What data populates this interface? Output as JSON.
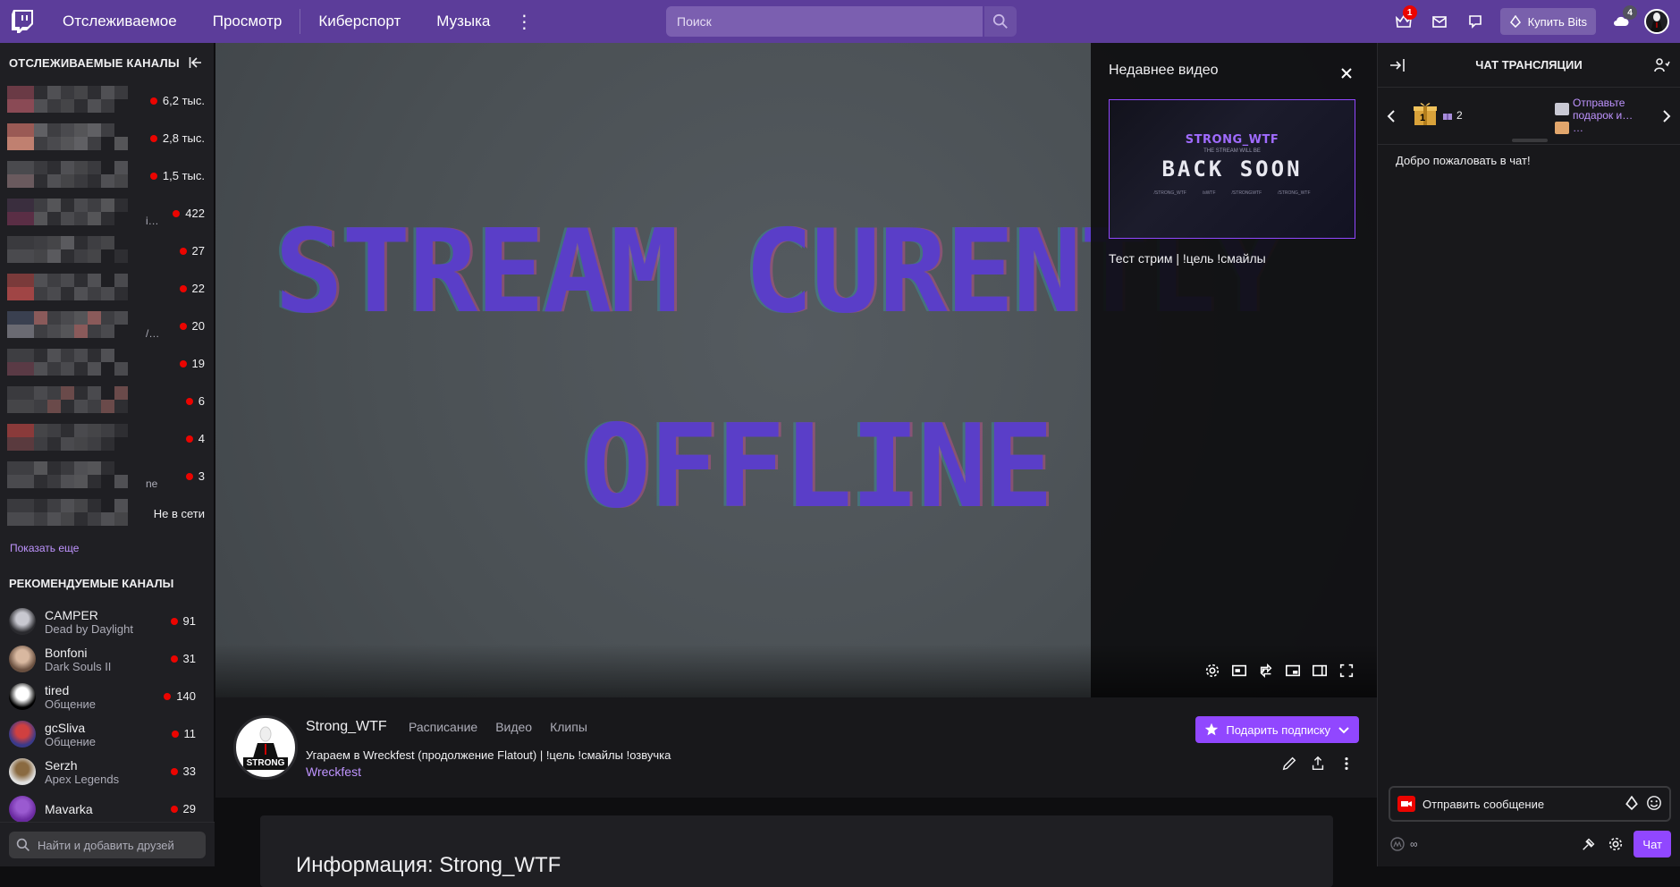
{
  "nav": {
    "links": [
      "Отслеживаемое",
      "Просмотр",
      "Киберспорт",
      "Музыка"
    ],
    "search_placeholder": "Поиск",
    "notifications_badge": "1",
    "buy_bits_label": "Купить Bits",
    "drops_badge": "4"
  },
  "sidebar": {
    "followed_header": "ОТСЛЕЖИВАЕМЫЕ КАНАЛЫ",
    "followed": [
      {
        "viewers": "6,2 тыс.",
        "trail": ""
      },
      {
        "viewers": "2,8 тыс.",
        "trail": ""
      },
      {
        "viewers": "1,5 тыс.",
        "trail": ""
      },
      {
        "viewers": "422",
        "trail": "i…"
      },
      {
        "viewers": "27",
        "trail": ""
      },
      {
        "viewers": "22",
        "trail": ""
      },
      {
        "viewers": "20",
        "trail": "/…"
      },
      {
        "viewers": "19",
        "trail": ""
      },
      {
        "viewers": "6",
        "trail": ""
      },
      {
        "viewers": "4",
        "trail": ""
      },
      {
        "viewers": "3",
        "trail": "ne"
      },
      {
        "viewers": "Не в сети",
        "trail": ""
      }
    ],
    "show_more": "Показать еще",
    "recommended_header": "РЕКОМЕНДУЕМЫЕ КАНАЛЫ",
    "recommended": [
      {
        "name": "CAMPER",
        "game": "Dead by Daylight",
        "viewers": "91"
      },
      {
        "name": "Bonfoni",
        "game": "Dark Souls II",
        "viewers": "31"
      },
      {
        "name": "tired",
        "game": "Общение",
        "viewers": "140"
      },
      {
        "name": "gcSliva",
        "game": "Общение",
        "viewers": "11"
      },
      {
        "name": "Serzh",
        "game": "Apex Legends",
        "viewers": "33"
      },
      {
        "name": "Mavarka",
        "game": "",
        "viewers": "29"
      }
    ],
    "friends_placeholder": "Найти и добавить друзей"
  },
  "player": {
    "offline_line1": "STREAM CURENTLY",
    "offline_line2": "OFFLINE",
    "recent_title": "Недавнее видео",
    "thumb_channel": "STRONG_WTF",
    "thumb_sub": "THE STREAM WILL BE",
    "thumb_main": "BACK SOON",
    "thumb_socials": [
      "/STRONG_WTF",
      "/sWTF",
      "/STRONGWTF",
      "/STRONG_WTF"
    ],
    "recent_caption": "Тест стрим | !цель !смайлы"
  },
  "info": {
    "channel_name": "Strong_WTF",
    "tabs": [
      "Расписание",
      "Видео",
      "Клипы"
    ],
    "stream_title": "Угараем в Wreckfest (продолжение Flatout) | !цель !смайлы !озвучка",
    "game": "Wreckfest",
    "gift_button": "Подарить подписку",
    "avatar_text": "STRONG",
    "about_title": "Информация: Strong_WTF"
  },
  "chat": {
    "header": "ЧАТ ТРАНСЛЯЦИИ",
    "gift_count": "1",
    "gift_subs": "2",
    "gift_line1": "Отправьте подарок и…",
    "gift_line2": "…",
    "welcome": "Добро пожаловать в чат!",
    "input_placeholder": "Отправить сообщение",
    "points": "∞",
    "send_label": "Чат"
  }
}
